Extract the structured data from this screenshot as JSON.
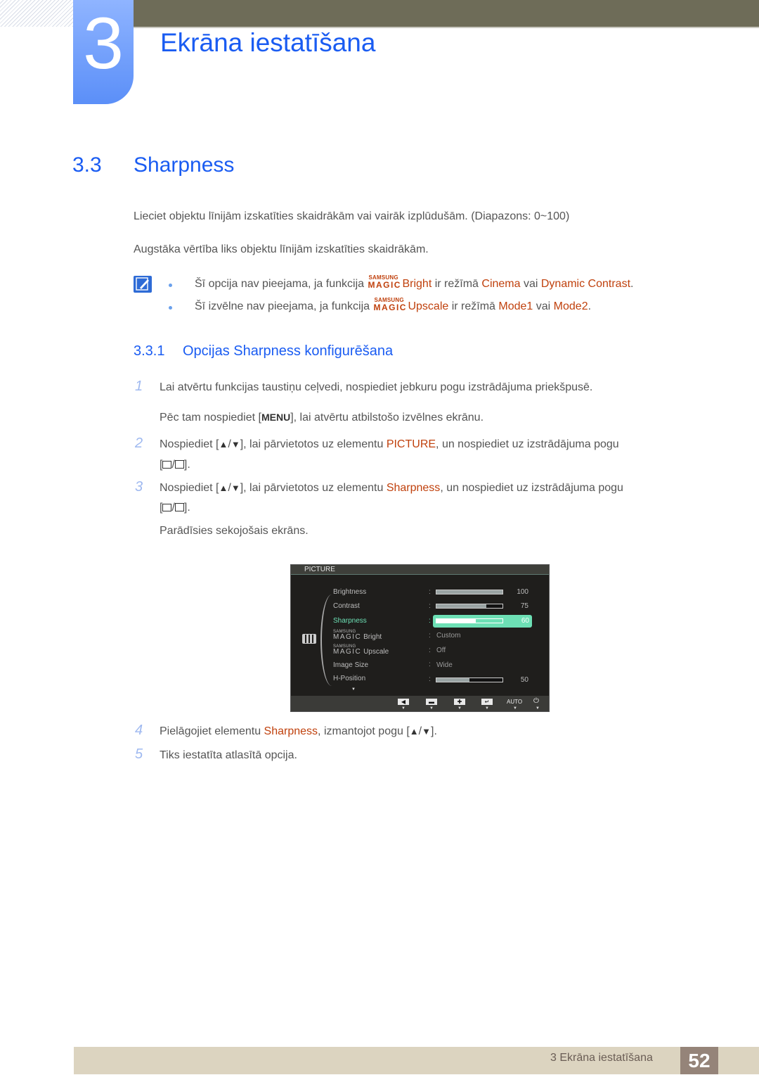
{
  "header": {
    "chapter_number": "3",
    "chapter_title": "Ekrāna iestatīšana"
  },
  "section": {
    "number": "3.3",
    "title": "Sharpness",
    "paragraphs": [
      "Lieciet objektu līnijām izskatīties skaidrākām vai vairāk izplūdušām. (Diapazons: 0~100)",
      "Augstāka vērtība liks objektu līnijām izskatīties skaidrākām."
    ]
  },
  "notes": {
    "icon": "note-pencil-icon",
    "items": [
      {
        "prefix": "Šī opcija nav pieejama, ja funkcija ",
        "magic_top": "SAMSUNG",
        "magic_bottom": "MAGIC",
        "feature": "Bright",
        "mid": " ir režīmā ",
        "opt1": "Cinema",
        "join": " vai ",
        "opt2": "Dynamic Contrast",
        "end": "."
      },
      {
        "prefix": "Šī izvēlne nav pieejama, ja funkcija ",
        "magic_top": "SAMSUNG",
        "magic_bottom": "MAGIC",
        "feature": "Upscale",
        "mid": " ir režīmā ",
        "opt1": "Mode1",
        "join": " vai ",
        "opt2": "Mode2",
        "end": "."
      }
    ]
  },
  "subsection": {
    "number": "3.3.1",
    "title": "Opcijas Sharpness konfigurēšana"
  },
  "steps": [
    {
      "num": "1",
      "text": "Lai atvērtu funkcijas taustiņu ceļvedi, nospiediet jebkuru pogu izstrādājuma priekšpusē.",
      "sub_a": "Pēc tam nospiediet [",
      "menu_key": "MENU",
      "sub_b": "], lai atvērtu atbilstošo izvēlnes ekrānu."
    },
    {
      "num": "2",
      "a": "Nospiediet [",
      "up": "▲",
      "slash": "/",
      "down": "▼",
      "b": "], lai pārvietotos uz elementu ",
      "hl": "PICTURE",
      "c": ", un nospiediet uz izstrādājuma pogu",
      "open": "[",
      "sep": "/",
      "close": "]."
    },
    {
      "num": "3",
      "a": "Nospiediet [",
      "up": "▲",
      "slash": "/",
      "down": "▼",
      "b": "], lai pārvietotos uz elementu ",
      "hl": "Sharpness",
      "c": ", un nospiediet uz izstrādājuma pogu",
      "open": "[",
      "sep": "/",
      "close": "].",
      "after": "Parādīsies sekojošais ekrāns."
    },
    {
      "num": "4",
      "a": "Pielāgojiet elementu ",
      "hl": "Sharpness",
      "b": ", izmantojot pogu [",
      "up": "▲",
      "slash": "/",
      "down": "▼",
      "c": "]."
    },
    {
      "num": "5",
      "a": "Tiks iestatīta atlasītā opcija."
    }
  ],
  "osd": {
    "title": "PICTURE",
    "rows": [
      {
        "label": "Brightness",
        "type": "bar",
        "value": 100
      },
      {
        "label": "Contrast",
        "type": "bar",
        "value": 75
      },
      {
        "label": "Sharpness",
        "type": "bar",
        "value": 60,
        "selected": true
      },
      {
        "label_top": "SAMSUNG",
        "label_magic": "MAGIC",
        "label": "Bright",
        "type": "text",
        "value": "Custom"
      },
      {
        "label_top": "SAMSUNG",
        "label_magic": "MAGIC",
        "label": "Upscale",
        "type": "text",
        "value": "Off"
      },
      {
        "label": "Image Size",
        "type": "text",
        "value": "Wide"
      },
      {
        "label": "H-Position",
        "type": "bar",
        "value": 50
      }
    ],
    "colon": ":",
    "more_indicator": "▼",
    "buttons": [
      {
        "name": "left-arrow-icon",
        "glyph": "◀"
      },
      {
        "name": "minus-icon",
        "glyph": "▬"
      },
      {
        "name": "plus-icon",
        "glyph": "✚"
      },
      {
        "name": "enter-icon",
        "glyph": "↵"
      },
      {
        "name": "auto-label",
        "glyph": "AUTO"
      },
      {
        "name": "power-icon",
        "glyph": "⏻"
      }
    ]
  },
  "footer": {
    "text": "3 Ekrāna iestatīšana",
    "page": "52"
  }
}
